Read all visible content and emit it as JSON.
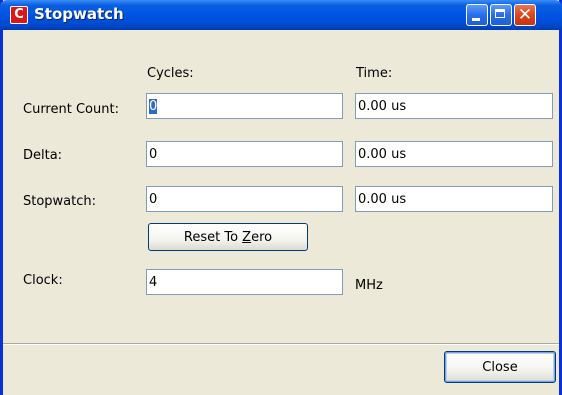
{
  "window": {
    "title": "Stopwatch",
    "icon_label": "C",
    "icon": "app-logo-icon",
    "controls": {
      "minimize": "minimize-icon",
      "maximize": "maximize-icon",
      "close": "close-icon"
    }
  },
  "columns": {
    "cycles": "Cycles:",
    "time": "Time:"
  },
  "rows": {
    "current_count": {
      "label": "Current Count:",
      "cycles": "0",
      "time": "0.00 us"
    },
    "delta": {
      "label": "Delta:",
      "cycles": "0",
      "time": "0.00 us"
    },
    "stopwatch": {
      "label": "Stopwatch:",
      "cycles": "0",
      "time": "0.00 us"
    }
  },
  "reset": {
    "label_before": "Reset To ",
    "label_mnemonic": "Z",
    "label_after": "ero"
  },
  "clock": {
    "label": "Clock:",
    "value": "4",
    "unit": "MHz"
  },
  "footer": {
    "close_label": "Close"
  },
  "colors": {
    "titlebar": "#0054e3",
    "window_bg": "#ece9d8",
    "field_border": "#7f9db9",
    "close_button": "#d9461c"
  }
}
